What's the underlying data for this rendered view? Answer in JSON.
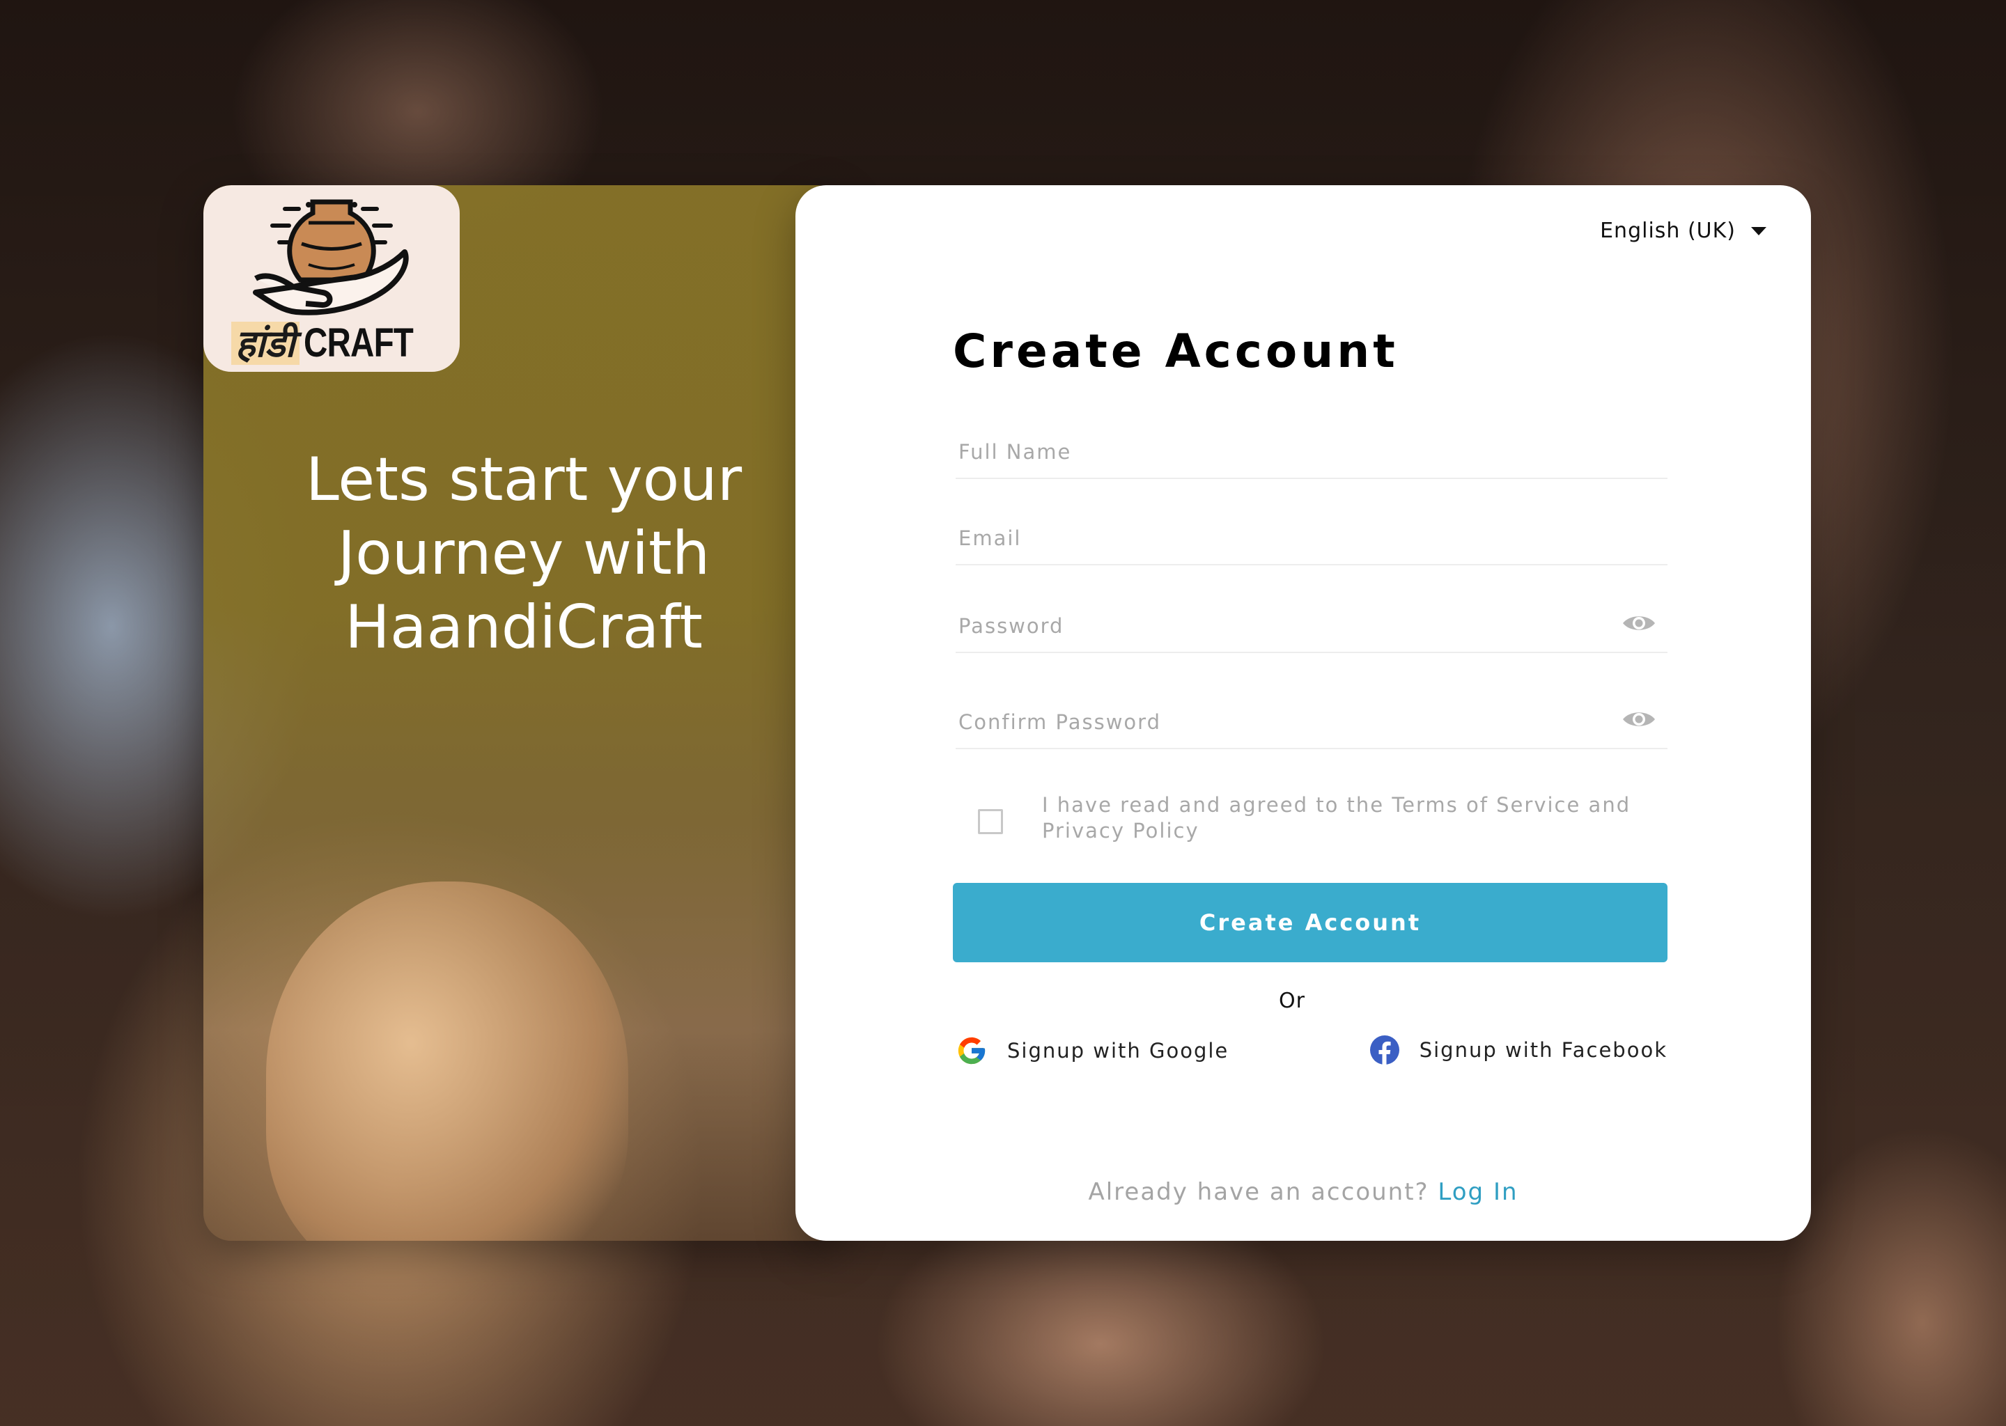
{
  "brand": {
    "logo_hindi": "हांडी",
    "logo_english": "CRAFT",
    "tagline": "Lets start your Journey with HaandiCraft"
  },
  "language": {
    "selected": "English (UK)"
  },
  "form": {
    "title": "Create Account",
    "full_name": {
      "placeholder": "Full Name",
      "value": ""
    },
    "email": {
      "placeholder": "Email",
      "value": ""
    },
    "password": {
      "placeholder": "Password",
      "value": ""
    },
    "confirm_password": {
      "placeholder": "Confirm Password",
      "value": ""
    },
    "terms_label": "I have read and agreed to the Terms of Service and Privacy Policy",
    "submit_label": "Create Account",
    "or_label": "Or",
    "google_label": "Signup with Google",
    "facebook_label": "Signup with Facebook",
    "footer_prompt": "Already have an account?",
    "login_link": "Log In"
  },
  "icons": {
    "language_dropdown": "caret-down-icon",
    "password_toggle": "eye-icon",
    "google": "google-icon",
    "facebook": "facebook-icon"
  },
  "colors": {
    "accent": "#3aaccd",
    "link": "#2f9ec2",
    "left_panel": "#867228",
    "placeholder": "#a8a8a8"
  }
}
